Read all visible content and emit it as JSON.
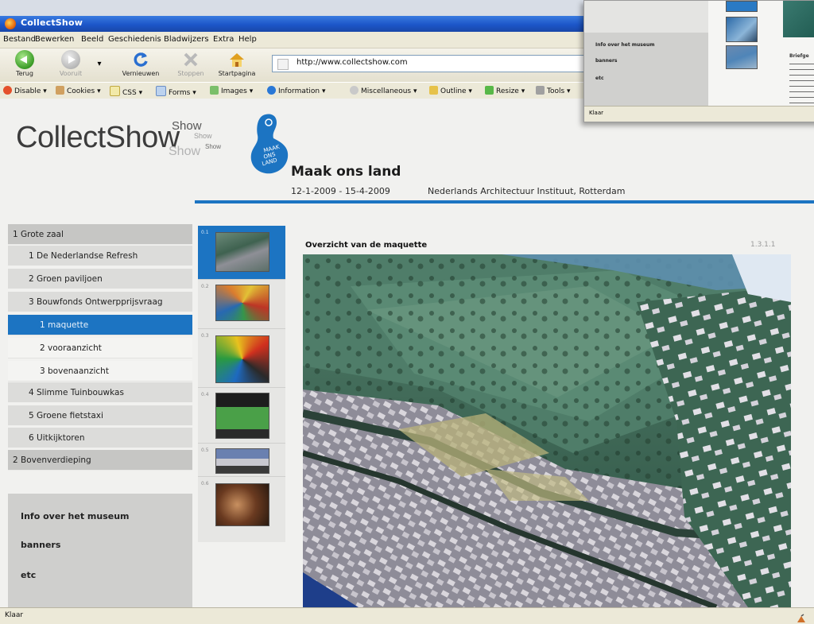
{
  "browser": {
    "title": "CollectShow",
    "menu": [
      "Bestand",
      "Bewerken",
      "Beeld",
      "Geschiedenis",
      "Bladwijzers",
      "Extra",
      "Help"
    ],
    "nav": {
      "back": "Terug",
      "forward": "Vooruit",
      "reload": "Vernieuwen",
      "stop": "Stoppen",
      "home": "Startpagina"
    },
    "url": "http://www.collectshow.com",
    "devtoolbar": [
      "Disable",
      "Cookies",
      "CSS",
      "Forms",
      "Images",
      "Information",
      "Miscellaneous",
      "Outline",
      "Resize",
      "Tools"
    ],
    "status": "Klaar"
  },
  "page": {
    "logo": "CollectShow",
    "logo_show": "Show",
    "event": {
      "title": "Maak ons land",
      "dates": "12-1-2009 - 15-4-2009",
      "place": "Nederlands Architectuur Instituut, Rotterdam",
      "logo_text": "MAAK ONS LAND"
    },
    "nav": [
      {
        "label": "1 Grote zaal",
        "level": 0
      },
      {
        "label": "1 De Nederlandse Refresh",
        "level": 1
      },
      {
        "label": "2 Groen paviljoen",
        "level": 1
      },
      {
        "label": "3 Bouwfonds Ontwerpprijsvraag",
        "level": 1
      },
      {
        "label": "1 maquette",
        "level": 2,
        "active": true
      },
      {
        "label": "2 vooraanzicht",
        "level": 2
      },
      {
        "label": "3 bovenaanzicht",
        "level": 2
      },
      {
        "label": "4 Slimme Tuinbouwkas",
        "level": 1
      },
      {
        "label": "5 Groene fietstaxi",
        "level": 1
      },
      {
        "label": "6 Uitkijktoren",
        "level": 1
      },
      {
        "label": "2 Bovenverdieping",
        "level": 0
      }
    ],
    "info_links": [
      "Info over het museum",
      "banners",
      "etc"
    ],
    "thumbnails": [
      "0.1",
      "0.2",
      "0.3",
      "0.4",
      "0.5",
      "0.6"
    ],
    "viewer": {
      "title": "Overzicht van de maquette",
      "code": "1.3.1.1"
    }
  },
  "inset": {
    "info_links": [
      "Info over het museum",
      "banners",
      "etc"
    ],
    "status": "Klaar",
    "text_heading": "Briefge"
  },
  "colors": {
    "accent": "#1c74c2",
    "nav_active_text": "#e8f1fa"
  }
}
